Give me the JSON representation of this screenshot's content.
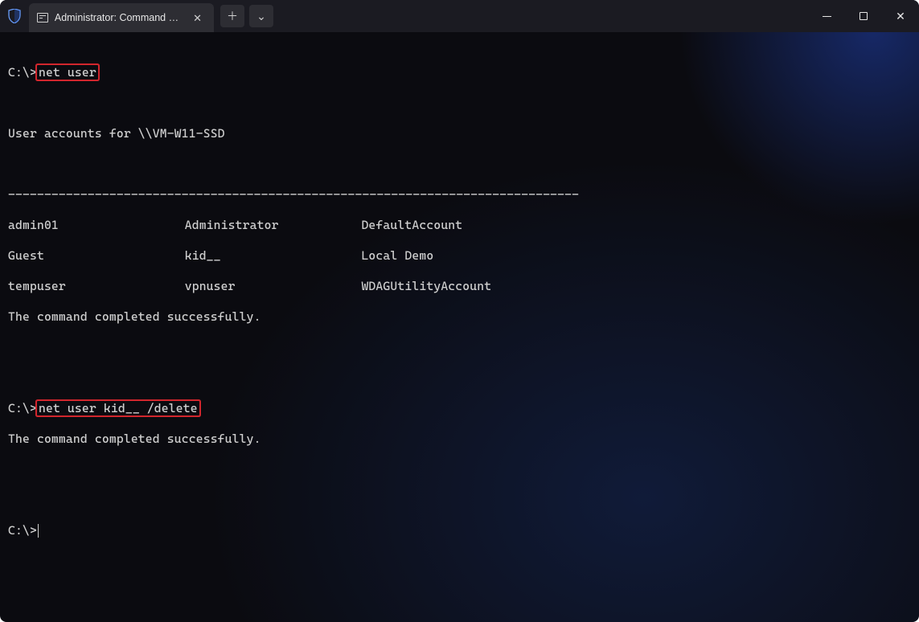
{
  "titlebar": {
    "tab_title": "Administrator: Command Pro",
    "tab_close_glyph": "✕",
    "new_tab_glyph": "＋",
    "dropdown_glyph": "⌄",
    "min_tooltip": "Minimize",
    "max_tooltip": "Maximize",
    "close_tooltip": "Close",
    "close_glyph": "✕"
  },
  "terminal": {
    "prompt": "C:\\>",
    "cmd1": "net user",
    "accounts_header": "User accounts for \\\\VM-W11-SSD",
    "separator": "-------------------------------------------------------------------------------",
    "users": {
      "r1c1": "admin01",
      "r1c2": "Administrator",
      "r1c3": "DefaultAccount",
      "r2c1": "Guest",
      "r2c2": "kid__",
      "r2c3": "Local Demo",
      "r3c1": "tempuser",
      "r3c2": "vpnuser",
      "r3c3": "WDAGUtilityAccount"
    },
    "success": "The command completed successfully.",
    "cmd2": "net user kid__ /delete"
  },
  "annotations": {
    "highlight_color": "#d2262d",
    "highlighted_commands": [
      "net user",
      "net user kid__ /delete"
    ]
  }
}
